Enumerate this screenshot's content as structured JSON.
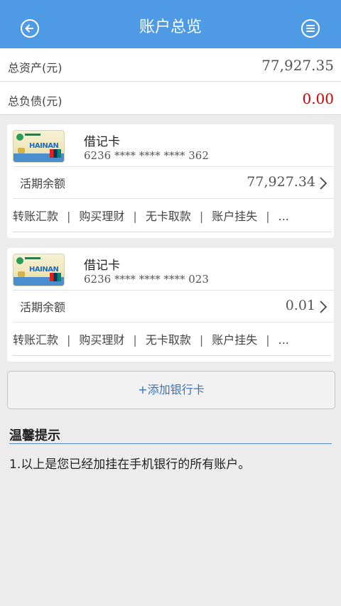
{
  "header": {
    "title": "账户总览",
    "back_icon": "back-arrow-icon",
    "menu_icon": "menu-icon",
    "color": "#4e9ae5"
  },
  "summary": {
    "total_assets_label": "总资产(元)",
    "total_assets_value": "77,927.35",
    "total_liabilities_label": "总负债(元)",
    "total_liabilities_value": "0.00",
    "liabilities_color": "#d00000"
  },
  "cards": [
    {
      "type": "借记卡",
      "number": "6236 **** **** **** 362",
      "balance_label": "活期余额",
      "balance": "77,927.34",
      "actions": [
        "转账汇款",
        "购买理财",
        "无卡取款",
        "账户挂失",
        "..."
      ]
    },
    {
      "type": "借记卡",
      "number": "6236 **** **** **** 023",
      "balance_label": "活期余额",
      "balance": "0.01",
      "actions": [
        "转账汇款",
        "购买理财",
        "无卡取款",
        "账户挂失",
        "..."
      ]
    }
  ],
  "card_image_text": "HAINAN",
  "add_card_label": "+添加银行卡",
  "tips": {
    "title": "温馨提示",
    "items": [
      "1.以上是您已经加挂在手机银行的所有账户。"
    ]
  }
}
